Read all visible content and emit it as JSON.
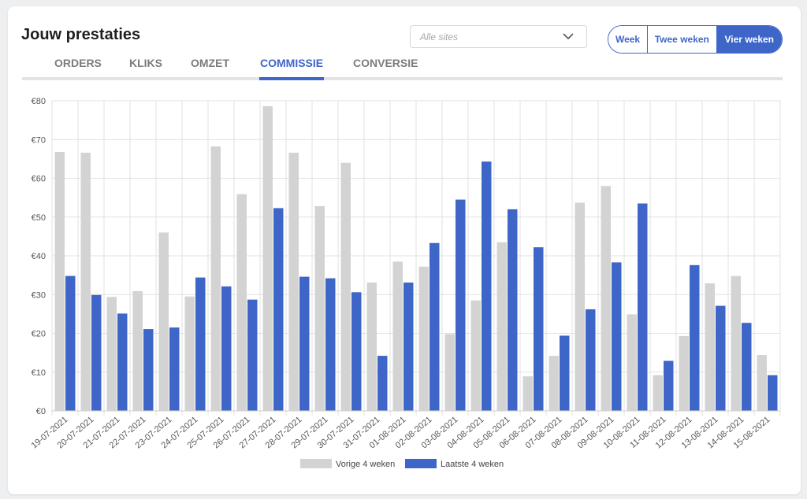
{
  "header": {
    "title": "Jouw prestaties",
    "site_select": {
      "placeholder": "Alle sites"
    },
    "period_buttons": [
      "Week",
      "Twee weken",
      "Vier weken"
    ],
    "active_period": "Vier weken"
  },
  "tabs": [
    {
      "label": "ORDERS"
    },
    {
      "label": "KLIKS"
    },
    {
      "label": "OMZET"
    },
    {
      "label": "COMMISSIE"
    },
    {
      "label": "CONVERSIE"
    }
  ],
  "active_tab": "COMMISSIE",
  "colors": {
    "accent": "#3e66c8",
    "previous": "#d3d3d3",
    "current": "#3e66c8"
  },
  "chart_data": {
    "type": "bar",
    "title": "",
    "xlabel": "",
    "ylabel": "",
    "ylim": [
      0,
      80
    ],
    "yticks": [
      "€0",
      "€10",
      "€20",
      "€30",
      "€40",
      "€50",
      "€60",
      "€70",
      "€80"
    ],
    "grid": true,
    "legend_position": "bottom",
    "categories": [
      "19-07-2021",
      "20-07-2021",
      "21-07-2021",
      "22-07-2021",
      "23-07-2021",
      "24-07-2021",
      "25-07-2021",
      "26-07-2021",
      "27-07-2021",
      "28-07-2021",
      "29-07-2021",
      "30-07-2021",
      "31-07-2021",
      "01-08-2021",
      "02-08-2021",
      "03-08-2021",
      "04-08-2021",
      "05-08-2021",
      "06-08-2021",
      "07-08-2021",
      "08-08-2021",
      "09-08-2021",
      "10-08-2021",
      "11-08-2021",
      "12-08-2021",
      "13-08-2021",
      "14-08-2021",
      "15-08-2021"
    ],
    "series": [
      {
        "name": "Vorige 4 weken",
        "color": "#d3d3d3",
        "values": [
          66.8,
          66.6,
          29.4,
          30.9,
          46.0,
          29.5,
          68.2,
          55.9,
          78.6,
          66.6,
          52.8,
          64.0,
          33.1,
          38.5,
          37.2,
          19.8,
          28.5,
          43.5,
          8.9,
          14.2,
          53.7,
          58.0,
          24.9,
          9.2,
          19.3,
          32.9,
          34.8,
          14.4
        ]
      },
      {
        "name": "Laatste 4 weken",
        "color": "#3e66c8",
        "values": [
          34.8,
          29.9,
          25.1,
          21.1,
          21.5,
          34.4,
          32.1,
          28.7,
          52.3,
          34.6,
          34.2,
          30.6,
          14.2,
          33.1,
          43.3,
          54.5,
          64.3,
          52.0,
          42.2,
          19.4,
          26.2,
          38.3,
          53.5,
          12.9,
          37.6,
          27.1,
          22.7,
          9.2
        ]
      }
    ]
  }
}
